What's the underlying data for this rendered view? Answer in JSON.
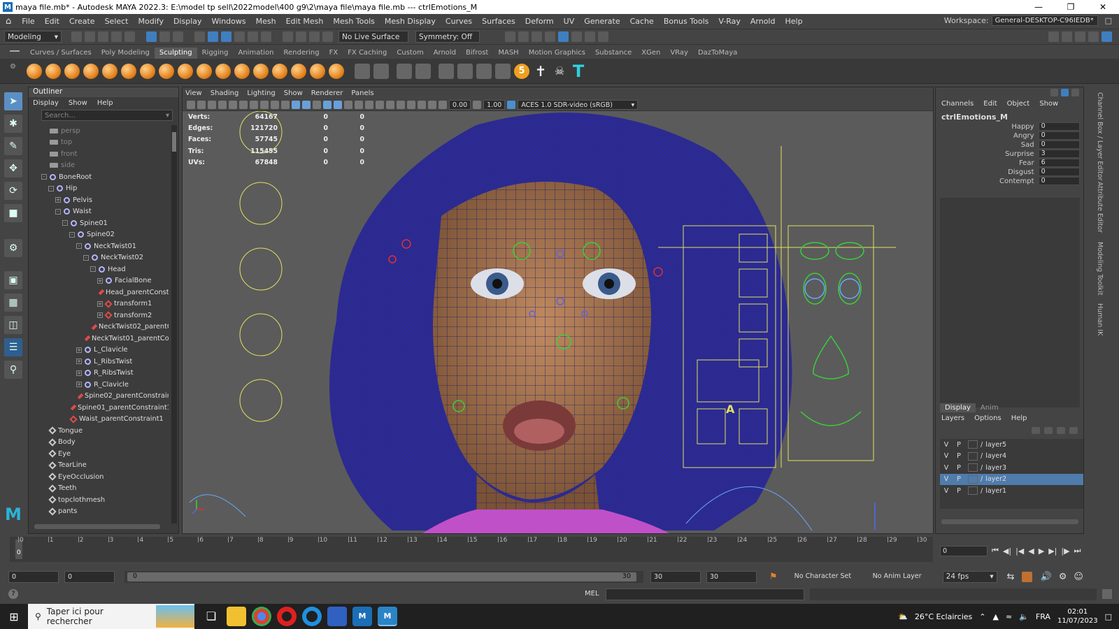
{
  "window": {
    "title": "maya file.mb* - Autodesk MAYA 2022.3: E:\\model tp sell\\2022model\\400 g9\\2\\maya file\\maya file.mb   ---   ctrlEmotions_M",
    "app_icon": "M"
  },
  "menubar": {
    "items": [
      "File",
      "Edit",
      "Create",
      "Select",
      "Modify",
      "Display",
      "Windows",
      "Mesh",
      "Edit Mesh",
      "Mesh Tools",
      "Mesh Display",
      "Curves",
      "Surfaces",
      "Deform",
      "UV",
      "Generate",
      "Cache",
      "Bonus Tools",
      "V-Ray",
      "Arnold",
      "Help"
    ],
    "workspace_label": "Workspace:",
    "workspace_value": "General-DESKTOP-C96IEDB*"
  },
  "statusline": {
    "mode": "Modeling",
    "live_surface": "No Live Surface",
    "symmetry": "Symmetry: Off"
  },
  "shelf": {
    "tabs": [
      "Curves / Surfaces",
      "Poly Modeling",
      "Sculpting",
      "Rigging",
      "Animation",
      "Rendering",
      "FX",
      "FX Caching",
      "Custom",
      "Arnold",
      "Bifrost",
      "MASH",
      "Motion Graphics",
      "Substance",
      "XGen",
      "VRay",
      "DazToMaya"
    ],
    "active_tab": "Sculpting",
    "badge_number": "5"
  },
  "outliner": {
    "title": "Outliner",
    "menu": [
      "Display",
      "Show",
      "Help"
    ],
    "search_placeholder": "Search...",
    "rows": [
      {
        "label": "persp",
        "indent": 1,
        "icon": "cam",
        "dim": true,
        "ex": ""
      },
      {
        "label": "top",
        "indent": 1,
        "icon": "cam",
        "dim": true,
        "ex": ""
      },
      {
        "label": "front",
        "indent": 1,
        "icon": "cam",
        "dim": true,
        "ex": ""
      },
      {
        "label": "side",
        "indent": 1,
        "icon": "cam",
        "dim": true,
        "ex": ""
      },
      {
        "label": "BoneRoot",
        "indent": 1,
        "icon": "joint",
        "ex": "-"
      },
      {
        "label": "Hip",
        "indent": 2,
        "icon": "joint",
        "ex": "-"
      },
      {
        "label": "Pelvis",
        "indent": 3,
        "icon": "joint",
        "ex": "+"
      },
      {
        "label": "Waist",
        "indent": 3,
        "icon": "joint",
        "ex": "-"
      },
      {
        "label": "Spine01",
        "indent": 4,
        "icon": "joint",
        "ex": "-"
      },
      {
        "label": "Spine02",
        "indent": 5,
        "icon": "joint",
        "ex": "-"
      },
      {
        "label": "NeckTwist01",
        "indent": 6,
        "icon": "joint",
        "ex": "-"
      },
      {
        "label": "NeckTwist02",
        "indent": 7,
        "icon": "joint",
        "ex": "-"
      },
      {
        "label": "Head",
        "indent": 8,
        "icon": "joint",
        "ex": "-"
      },
      {
        "label": "FacialBone",
        "indent": 9,
        "icon": "joint",
        "ex": "+"
      },
      {
        "label": "Head_parentConst",
        "indent": 9,
        "icon": "cons",
        "ex": ""
      },
      {
        "label": "transform1",
        "indent": 9,
        "icon": "cons",
        "ex": "+"
      },
      {
        "label": "transform2",
        "indent": 9,
        "icon": "cons",
        "ex": "+"
      },
      {
        "label": "NeckTwist02_parentC",
        "indent": 8,
        "icon": "cons",
        "ex": ""
      },
      {
        "label": "NeckTwist01_parentCo",
        "indent": 7,
        "icon": "cons",
        "ex": ""
      },
      {
        "label": "L_Clavicle",
        "indent": 6,
        "icon": "joint",
        "ex": "+"
      },
      {
        "label": "L_RibsTwist",
        "indent": 6,
        "icon": "joint",
        "ex": "+"
      },
      {
        "label": "R_RibsTwist",
        "indent": 6,
        "icon": "joint",
        "ex": "+"
      },
      {
        "label": "R_Clavicle",
        "indent": 6,
        "icon": "joint",
        "ex": "+"
      },
      {
        "label": "Spine02_parentConstrain",
        "indent": 6,
        "icon": "cons",
        "ex": ""
      },
      {
        "label": "Spine01_parentConstraint1",
        "indent": 5,
        "icon": "cons",
        "ex": ""
      },
      {
        "label": "Waist_parentConstraint1",
        "indent": 4,
        "icon": "cons",
        "ex": ""
      },
      {
        "label": "Tongue",
        "indent": 1,
        "icon": "mesh",
        "ex": ""
      },
      {
        "label": "Body",
        "indent": 1,
        "icon": "mesh",
        "ex": ""
      },
      {
        "label": "Eye",
        "indent": 1,
        "icon": "mesh",
        "ex": ""
      },
      {
        "label": "TearLine",
        "indent": 1,
        "icon": "mesh",
        "ex": ""
      },
      {
        "label": "EyeOcclusion",
        "indent": 1,
        "icon": "mesh",
        "ex": ""
      },
      {
        "label": "Teeth",
        "indent": 1,
        "icon": "mesh",
        "ex": ""
      },
      {
        "label": "topclothmesh",
        "indent": 1,
        "icon": "mesh",
        "ex": ""
      },
      {
        "label": "pants",
        "indent": 1,
        "icon": "mesh",
        "ex": ""
      }
    ]
  },
  "viewport": {
    "menu": [
      "View",
      "Shading",
      "Lighting",
      "Show",
      "Renderer",
      "Panels"
    ],
    "exposure": "0.00",
    "gamma": "1.00",
    "colorspace": "ACES 1.0 SDR-video (sRGB)",
    "hud": [
      {
        "key": "Verts:",
        "val": "64167",
        "a": "0",
        "b": "0"
      },
      {
        "key": "Edges:",
        "val": "121720",
        "a": "0",
        "b": "0"
      },
      {
        "key": "Faces:",
        "val": "57745",
        "a": "0",
        "b": "0"
      },
      {
        "key": "Tris:",
        "val": "115455",
        "a": "0",
        "b": "0"
      },
      {
        "key": "UVs:",
        "val": "67848",
        "a": "0",
        "b": "0"
      }
    ]
  },
  "channelbox": {
    "menu": [
      "Channels",
      "Edit",
      "Object",
      "Show"
    ],
    "object": "ctrlEmotions_M",
    "attrs": [
      {
        "name": "Happy",
        "value": "0"
      },
      {
        "name": "Angry",
        "value": "0"
      },
      {
        "name": "Sad",
        "value": "0"
      },
      {
        "name": "Surprise",
        "value": "3"
      },
      {
        "name": "Fear",
        "value": "6"
      },
      {
        "name": "Disgust",
        "value": "0"
      },
      {
        "name": "Contempt",
        "value": "0"
      }
    ]
  },
  "layers": {
    "tabs": [
      "Display",
      "Anim"
    ],
    "menu": [
      "Layers",
      "Options",
      "Help"
    ],
    "rows": [
      {
        "v": "V",
        "p": "P",
        "name": "layer5",
        "sel": false
      },
      {
        "v": "V",
        "p": "P",
        "name": "layer4",
        "sel": false
      },
      {
        "v": "V",
        "p": "P",
        "name": "layer3",
        "sel": false
      },
      {
        "v": "V",
        "p": "P",
        "name": "layer2",
        "sel": true
      },
      {
        "v": "V",
        "p": "P",
        "name": "layer1",
        "sel": false
      }
    ]
  },
  "sidetabs": [
    "Channel Box / Layer Editor",
    "Attribute Editor",
    "Modeling Toolkit",
    "Human IK"
  ],
  "timeline": {
    "current_frame_marker": "0",
    "labels": [
      "0",
      "1",
      "2",
      "3",
      "4",
      "5",
      "6",
      "7",
      "8",
      "9",
      "10",
      "11",
      "12",
      "13",
      "14",
      "15",
      "16",
      "17",
      "18",
      "19",
      "20",
      "21",
      "22",
      "23",
      "24",
      "25",
      "26",
      "27",
      "28",
      "29",
      "30"
    ],
    "current_frame": "0"
  },
  "range": {
    "start_outer": "0",
    "start_inner": "0",
    "range_min": "0",
    "range_max": "30",
    "end_inner": "30",
    "end_outer": "30",
    "character_set": "No Character Set",
    "anim_layer": "No Anim Layer",
    "fps": "24 fps"
  },
  "cmdline": {
    "lang": "MEL"
  },
  "taskbar": {
    "search_placeholder": "Taper ici pour rechercher",
    "weather": "26°C  Eclaircies",
    "lang": "FRA",
    "time": "02:01",
    "date": "11/07/2023"
  }
}
